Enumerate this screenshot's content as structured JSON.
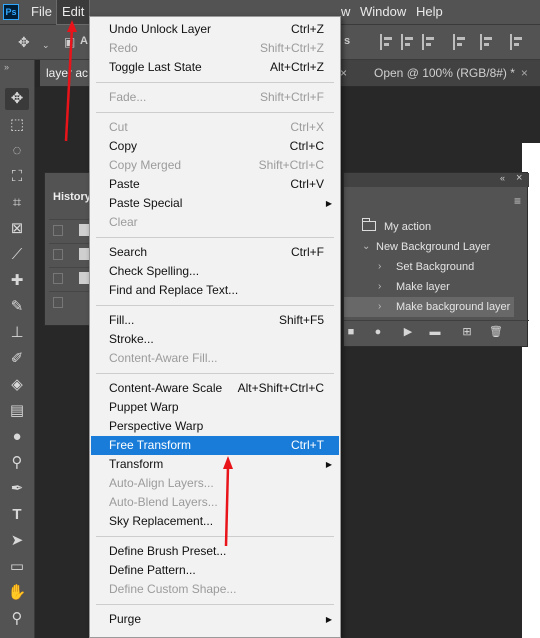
{
  "menubar": {
    "logo": "Ps",
    "items": [
      {
        "name": "menu-file",
        "label": "File"
      },
      {
        "name": "menu-edit",
        "label": "Edit"
      },
      {
        "name": "menu-view-partial",
        "label": "w"
      },
      {
        "name": "menu-window",
        "label": "Window"
      },
      {
        "name": "menu-help",
        "label": "Help"
      }
    ]
  },
  "optionsbar": {
    "move_icon": "move-icon",
    "auto_select_partial": "A",
    "right_partial": "s"
  },
  "tabs": [
    {
      "label": "layer ac",
      "close": ""
    },
    {
      "label": "Open @ 100% (RGB/8#) *",
      "close": "×"
    }
  ],
  "tabbar_close_partial": "×",
  "history": {
    "title": "History",
    "rows": 4
  },
  "actions": {
    "set_name": "My action",
    "action_name": "New Background Layer",
    "steps": [
      "Set Background",
      "Make layer",
      "Make background layer"
    ],
    "selected_step": 2
  },
  "edit_menu": {
    "groups": [
      [
        {
          "label": "Undo Unlock Layer",
          "shortcut": "Ctrl+Z",
          "enabled": true
        },
        {
          "label": "Redo",
          "shortcut": "Shift+Ctrl+Z",
          "enabled": false
        },
        {
          "label": "Toggle Last State",
          "shortcut": "Alt+Ctrl+Z",
          "enabled": true
        }
      ],
      [
        {
          "label": "Fade...",
          "shortcut": "Shift+Ctrl+F",
          "enabled": false
        }
      ],
      [
        {
          "label": "Cut",
          "shortcut": "Ctrl+X",
          "enabled": false
        },
        {
          "label": "Copy",
          "shortcut": "Ctrl+C",
          "enabled": true
        },
        {
          "label": "Copy Merged",
          "shortcut": "Shift+Ctrl+C",
          "enabled": false
        },
        {
          "label": "Paste",
          "shortcut": "Ctrl+V",
          "enabled": true
        },
        {
          "label": "Paste Special",
          "shortcut": "",
          "enabled": true,
          "submenu": true
        },
        {
          "label": "Clear",
          "shortcut": "",
          "enabled": false
        }
      ],
      [
        {
          "label": "Search",
          "shortcut": "Ctrl+F",
          "enabled": true
        },
        {
          "label": "Check Spelling...",
          "shortcut": "",
          "enabled": true
        },
        {
          "label": "Find and Replace Text...",
          "shortcut": "",
          "enabled": true
        }
      ],
      [
        {
          "label": "Fill...",
          "shortcut": "Shift+F5",
          "enabled": true
        },
        {
          "label": "Stroke...",
          "shortcut": "",
          "enabled": true
        },
        {
          "label": "Content-Aware Fill...",
          "shortcut": "",
          "enabled": false
        }
      ],
      [
        {
          "label": "Content-Aware Scale",
          "shortcut": "Alt+Shift+Ctrl+C",
          "enabled": true
        },
        {
          "label": "Puppet Warp",
          "shortcut": "",
          "enabled": true
        },
        {
          "label": "Perspective Warp",
          "shortcut": "",
          "enabled": true
        },
        {
          "label": "Free Transform",
          "shortcut": "Ctrl+T",
          "enabled": true,
          "highlighted": true
        },
        {
          "label": "Transform",
          "shortcut": "",
          "enabled": true,
          "submenu": true
        },
        {
          "label": "Auto-Align Layers...",
          "shortcut": "",
          "enabled": false
        },
        {
          "label": "Auto-Blend Layers...",
          "shortcut": "",
          "enabled": false
        },
        {
          "label": "Sky Replacement...",
          "shortcut": "",
          "enabled": true
        }
      ],
      [
        {
          "label": "Define Brush Preset...",
          "shortcut": "",
          "enabled": true
        },
        {
          "label": "Define Pattern...",
          "shortcut": "",
          "enabled": true
        },
        {
          "label": "Define Custom Shape...",
          "shortcut": "",
          "enabled": false
        }
      ],
      [
        {
          "label": "Purge",
          "shortcut": "",
          "enabled": true,
          "submenu": true
        }
      ]
    ]
  },
  "tools": [
    "move-tool",
    "marquee-tool",
    "lasso-tool",
    "object-selection-tool",
    "crop-tool",
    "frame-tool",
    "eyedropper-tool",
    "healing-brush-tool",
    "brush-tool",
    "clone-stamp-tool",
    "history-brush-tool",
    "eraser-tool",
    "gradient-tool",
    "blur-tool",
    "dodge-tool",
    "pen-tool",
    "type-tool",
    "path-selection-tool",
    "rectangle-tool",
    "hand-tool",
    "zoom-tool"
  ],
  "colors": {
    "menu_highlight": "#1a7cd9",
    "annotation_arrow": "#e8141a",
    "ui_panel": "#535353"
  }
}
